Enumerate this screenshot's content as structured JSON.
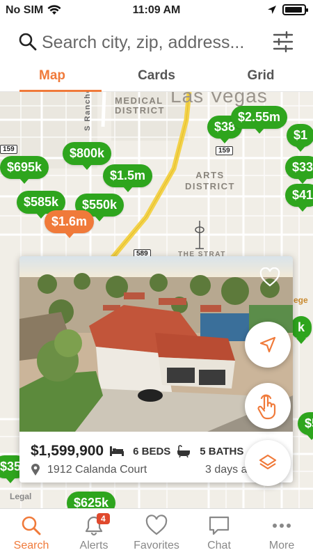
{
  "status_bar": {
    "carrier": "No SIM",
    "time": "11:09 AM"
  },
  "search": {
    "placeholder": "Search city, zip, address..."
  },
  "view_tabs": [
    {
      "label": "Map",
      "active": true
    },
    {
      "label": "Cards",
      "active": false
    },
    {
      "label": "Grid",
      "active": false
    }
  ],
  "map": {
    "labels": {
      "city": "Las Vegas",
      "medical_district": "MEDICAL DISTRICT",
      "arts_district": "ARTS DISTRICT",
      "strat": "THE STRAT",
      "rancho": "S Rancho Dr",
      "legal": "Legal",
      "college": "ege"
    },
    "road_signs": {
      "r159a": "159",
      "r159b": "159",
      "r589": "589"
    },
    "price_pins": [
      {
        "label": "$695k"
      },
      {
        "label": "$800k"
      },
      {
        "label": "$1.5m"
      },
      {
        "label": "$585k"
      },
      {
        "label": "$550k"
      },
      {
        "label": "$1.6m",
        "selected": true
      },
      {
        "label": "$38"
      },
      {
        "label": "$2.55m"
      },
      {
        "label": "$1"
      },
      {
        "label": "$33"
      },
      {
        "label": "$41"
      },
      {
        "label": "$35"
      },
      {
        "label": "$625k"
      },
      {
        "label": "k"
      },
      {
        "label": "$5"
      }
    ],
    "colors": {
      "pin": "#2ea51d",
      "pin_selected": "#f07a3a",
      "accent": "#f07a3a"
    }
  },
  "listing": {
    "price": "$1,599,900",
    "beds": "6 BEDS",
    "baths": "5 BATHS",
    "address": "1912 Calanda Court",
    "days": "3 days a"
  },
  "bottom_tabs": [
    {
      "label": "Search",
      "icon": "search-icon",
      "active": true
    },
    {
      "label": "Alerts",
      "icon": "bell-icon",
      "badge": "4"
    },
    {
      "label": "Favorites",
      "icon": "heart-icon"
    },
    {
      "label": "Chat",
      "icon": "chat-icon"
    },
    {
      "label": "More",
      "icon": "more-icon"
    }
  ]
}
